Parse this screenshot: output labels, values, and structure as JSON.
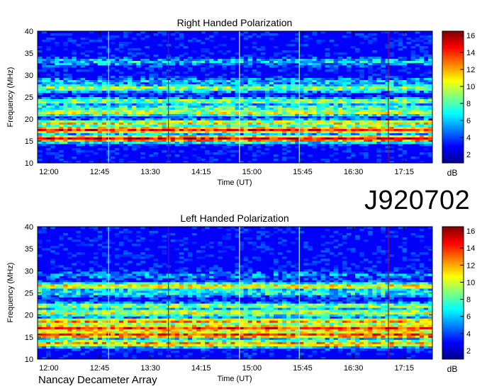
{
  "observation_id": "J920702",
  "credit": "Nancay Decameter Array",
  "chart_data": [
    {
      "type": "heatmap",
      "title": "Right Handed Polarization",
      "xlabel": "Time (UT)",
      "ylabel": "Frequency (MHz)",
      "x_ticks": [
        "12:00",
        "12:45",
        "13:30",
        "14:15",
        "15:00",
        "15:45",
        "16:30",
        "17:15"
      ],
      "y_ticks": [
        "10",
        "15",
        "20",
        "25",
        "30",
        "35",
        "40"
      ],
      "ylim": [
        10,
        40
      ],
      "xlim_minutes": [
        710,
        1060
      ],
      "colorbar": {
        "label": "dB",
        "ticks": [
          "2",
          "4",
          "6",
          "8",
          "10",
          "12",
          "14",
          "16"
        ],
        "range": [
          1,
          16.5
        ]
      },
      "bands": [
        {
          "freq": 15.5,
          "level": 15
        },
        {
          "freq": 17.5,
          "level": 14
        },
        {
          "freq": 19.0,
          "level": 11
        },
        {
          "freq": 21.5,
          "level": 10
        },
        {
          "freq": 22.5,
          "level": 8
        },
        {
          "freq": 24.0,
          "level": 9
        },
        {
          "freq": 27.0,
          "level": 9
        },
        {
          "freq": 28.5,
          "level": 6
        },
        {
          "freq": 33.0,
          "level": 6
        }
      ],
      "vertical_lines": [
        {
          "time_min": 773,
          "color": "#7fffc0"
        },
        {
          "time_min": 826,
          "color": "#c00000"
        },
        {
          "time_min": 889,
          "color": "#ffffa0"
        },
        {
          "time_min": 942,
          "color": "#80ffff"
        },
        {
          "time_min": 1021,
          "color": "#c00000"
        }
      ]
    },
    {
      "type": "heatmap",
      "title": "Left Handed Polarization",
      "xlabel": "Time (UT)",
      "ylabel": "Frequency (MHz)",
      "x_ticks": [
        "12:00",
        "12:45",
        "13:30",
        "14:15",
        "15:00",
        "15:45",
        "16:30",
        "17:15"
      ],
      "y_ticks": [
        "10",
        "15",
        "20",
        "25",
        "30",
        "35",
        "40"
      ],
      "ylim": [
        10,
        40
      ],
      "xlim_minutes": [
        710,
        1060
      ],
      "colorbar": {
        "label": "dB",
        "ticks": [
          "2",
          "4",
          "6",
          "8",
          "10",
          "12",
          "14",
          "16"
        ],
        "range": [
          1,
          16.5
        ]
      },
      "bands": [
        {
          "freq": 13.5,
          "level": 12
        },
        {
          "freq": 15.5,
          "level": 14
        },
        {
          "freq": 17.0,
          "level": 14
        },
        {
          "freq": 18.5,
          "level": 12
        },
        {
          "freq": 20.5,
          "level": 10
        },
        {
          "freq": 22.0,
          "level": 9
        },
        {
          "freq": 25.0,
          "level": 7
        },
        {
          "freq": 26.5,
          "level": 11
        },
        {
          "freq": 29.0,
          "level": 5
        }
      ],
      "vertical_lines": [
        {
          "time_min": 773,
          "color": "#7fffc0"
        },
        {
          "time_min": 826,
          "color": "#c00000"
        },
        {
          "time_min": 889,
          "color": "#ffffa0"
        },
        {
          "time_min": 942,
          "color": "#80ffff"
        },
        {
          "time_min": 1021,
          "color": "#c00000"
        }
      ]
    }
  ]
}
